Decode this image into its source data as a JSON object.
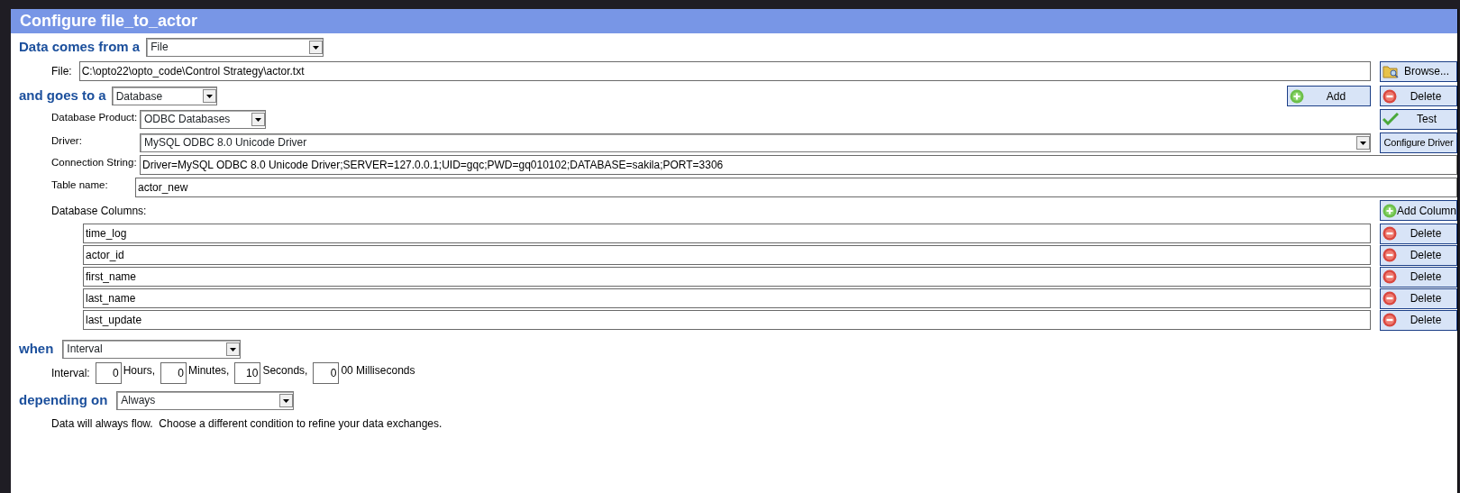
{
  "window": {
    "title": "Configure file_to_actor"
  },
  "source": {
    "label": "Data comes from a",
    "value": "File",
    "file_label": "File:",
    "file_path": "C:\\opto22\\opto_code\\Control Strategy\\actor.txt",
    "browse_button": "Browse..."
  },
  "destination": {
    "label": "and goes to a",
    "value": "Database",
    "add_button": "Add",
    "delete_button": "Delete",
    "fields": [
      {
        "kind": "select",
        "label": "Database Product:",
        "value": "ODBC Databases",
        "button": "Test"
      },
      {
        "kind": "wideselect",
        "label": "Driver:",
        "value": "MySQL ODBC 8.0 Unicode Driver",
        "button": "Configure Driver"
      },
      {
        "kind": "input",
        "label": "Connection String:",
        "value": "Driver=MySQL ODBC 8.0 Unicode Driver;SERVER=127.0.0.1;UID=gqc;PWD=gq010102;DATABASE=sakila;PORT=3306"
      },
      {
        "kind": "input",
        "label": "Table name:",
        "value": "actor_new"
      }
    ]
  },
  "columns": {
    "label": "Database Columns:",
    "add_button": "Add Column",
    "items": [
      {
        "name": "time_log",
        "button": "Delete"
      },
      {
        "name": "actor_id",
        "button": "Delete"
      },
      {
        "name": "first_name",
        "button": "Delete"
      },
      {
        "name": "last_name",
        "button": "Delete"
      },
      {
        "name": "last_update",
        "button": "Delete"
      }
    ]
  },
  "schedule": {
    "label": "when",
    "value": "Interval",
    "interval_label": "Interval:",
    "units": [
      {
        "value": "0",
        "unit": "Hours,"
      },
      {
        "value": "0",
        "unit": "Minutes,"
      },
      {
        "value": "10",
        "unit": "Seconds,"
      },
      {
        "value": "0",
        "unit": "00 Milliseconds"
      }
    ]
  },
  "condition": {
    "label": "depending on",
    "value": "Always",
    "message": "Data will always flow.  Choose a different condition to refine your data exchanges."
  }
}
